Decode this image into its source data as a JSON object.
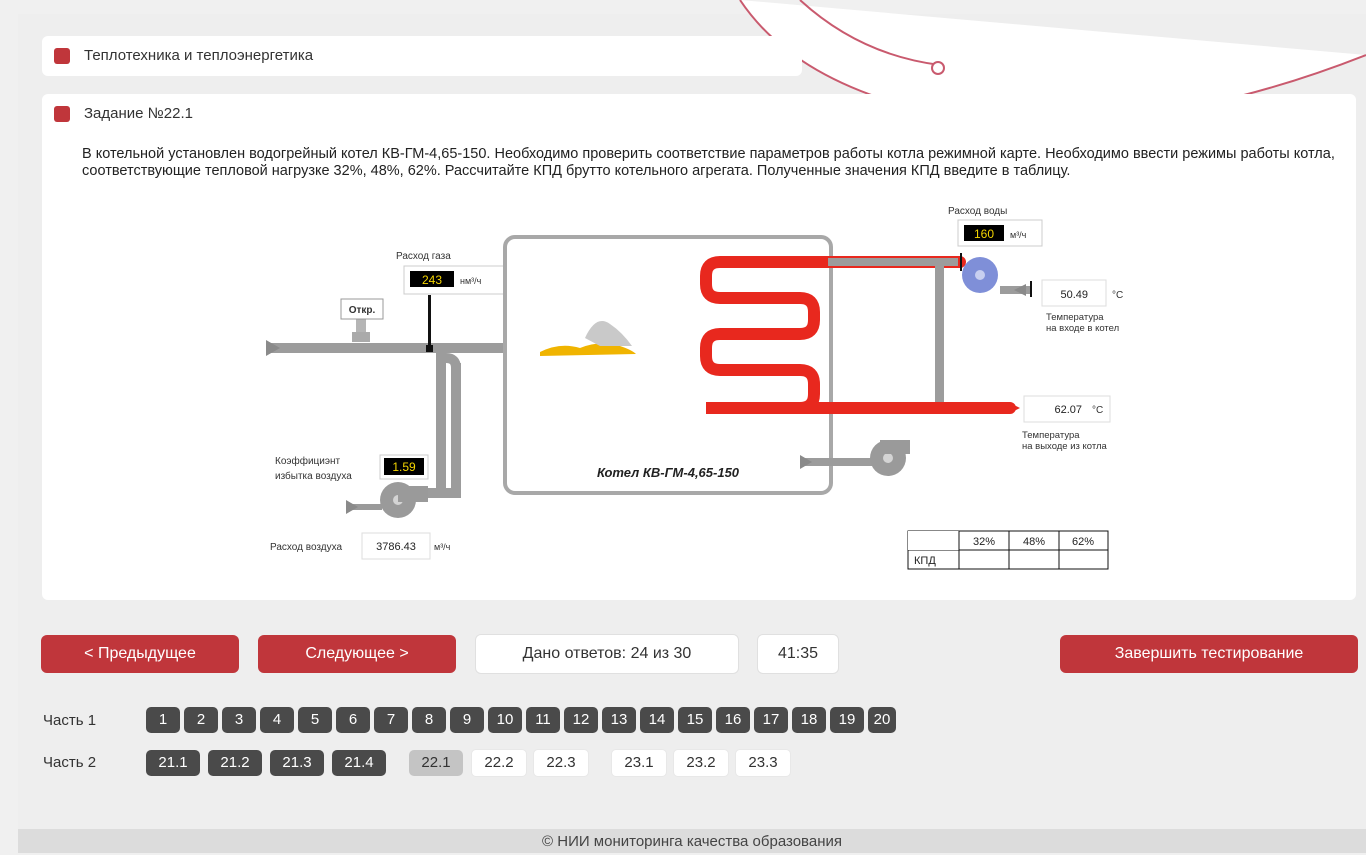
{
  "section_title": "Теплотехника и теплоэнергетика",
  "task": {
    "title": "Задание №22.1",
    "description": "В котельной установлен водогрейный котел КВ-ГМ-4,65-150. Необходимо проверить соответствие параметров работы котла режимной карте. Необходимо ввести режимы работы котла, соответствующие тепловой нагрузке 32%, 48%, 62%. Рассчитайте КПД брутто котельного агрегата. Полученные значения КПД введите в таблицу."
  },
  "diagram": {
    "gas_flow_label": "Расход газа",
    "gas_flow_value": "243",
    "gas_flow_unit": "нм³/ч",
    "valve_label": "Откр.",
    "air_coef_label_1": "Коэффициэнт",
    "air_coef_label_2": "избытка воздуха",
    "air_coef_value": "1.59",
    "air_flow_label": "Расход воздуха",
    "air_flow_value": "3786.43",
    "air_flow_unit": "м³/ч",
    "water_flow_label": "Расход воды",
    "water_flow_value": "160",
    "water_flow_unit": "м³/ч",
    "temp_in_value": "50.49",
    "temp_in_unit": "°C",
    "temp_in_label_1": "Температура",
    "temp_in_label_2": "на входе в котел",
    "temp_out_value": "62.07",
    "temp_out_unit": "°C",
    "temp_out_label_1": "Температура",
    "temp_out_label_2": "на выходе из котла",
    "boiler_label": "Котел КВ-ГМ-4,65-150"
  },
  "table": {
    "headers": [
      "32%",
      "48%",
      "62%"
    ],
    "row_label": "КПД"
  },
  "nav": {
    "prev_label": "< Предыдущее",
    "next_label": "Следующее >",
    "answers_text": "Дано ответов: 24 из 30",
    "timer": "41:35",
    "finish_label": "Завершить тестирование"
  },
  "parts": {
    "part1_label": "Часть 1",
    "part2_label": "Часть 2",
    "part1": [
      "1",
      "2",
      "3",
      "4",
      "5",
      "6",
      "7",
      "8",
      "9",
      "10",
      "11",
      "12",
      "13",
      "14",
      "15",
      "16",
      "17",
      "18",
      "19",
      "20"
    ],
    "part2": [
      "21.1",
      "21.2",
      "21.3",
      "21.4",
      "22.1",
      "22.2",
      "22.3",
      "23.1",
      "23.2",
      "23.3"
    ]
  },
  "footer": "НИИ мониторинга качества образования",
  "colors": {
    "accent": "#c0363b",
    "coil": "#e8281e",
    "display_bg": "#000000",
    "display_text": "#f4d400"
  }
}
